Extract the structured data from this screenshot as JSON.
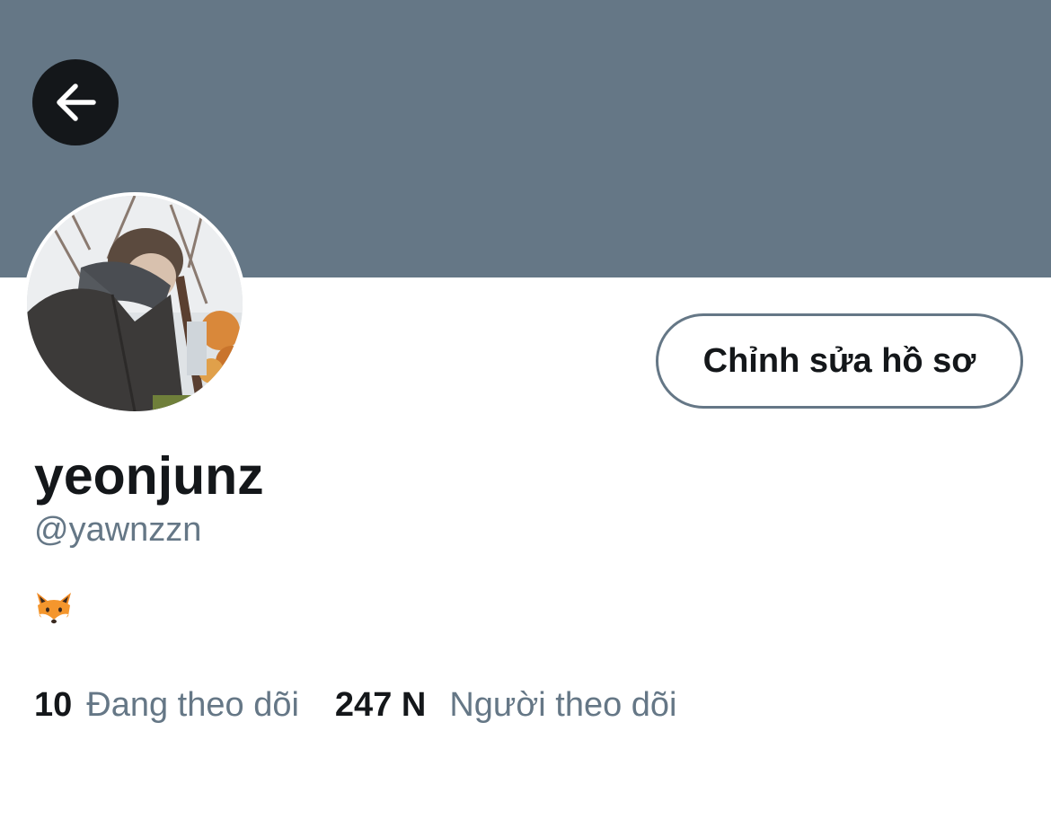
{
  "colors": {
    "banner": "#657786",
    "text_primary": "#14171a",
    "text_secondary": "#657786",
    "back_button_bg": "#14171a"
  },
  "header": {
    "back_icon": "arrow-left-icon"
  },
  "profile": {
    "edit_button_label": "Chỉnh sửa hồ sơ",
    "display_name": "yeonjunz",
    "handle": "@yawnzzn",
    "bio_emoji": "fox-face-icon"
  },
  "stats": {
    "following_count": "10",
    "following_label": "Đang theo dõi",
    "followers_count": "247 N",
    "followers_label": "Người theo dõi"
  }
}
